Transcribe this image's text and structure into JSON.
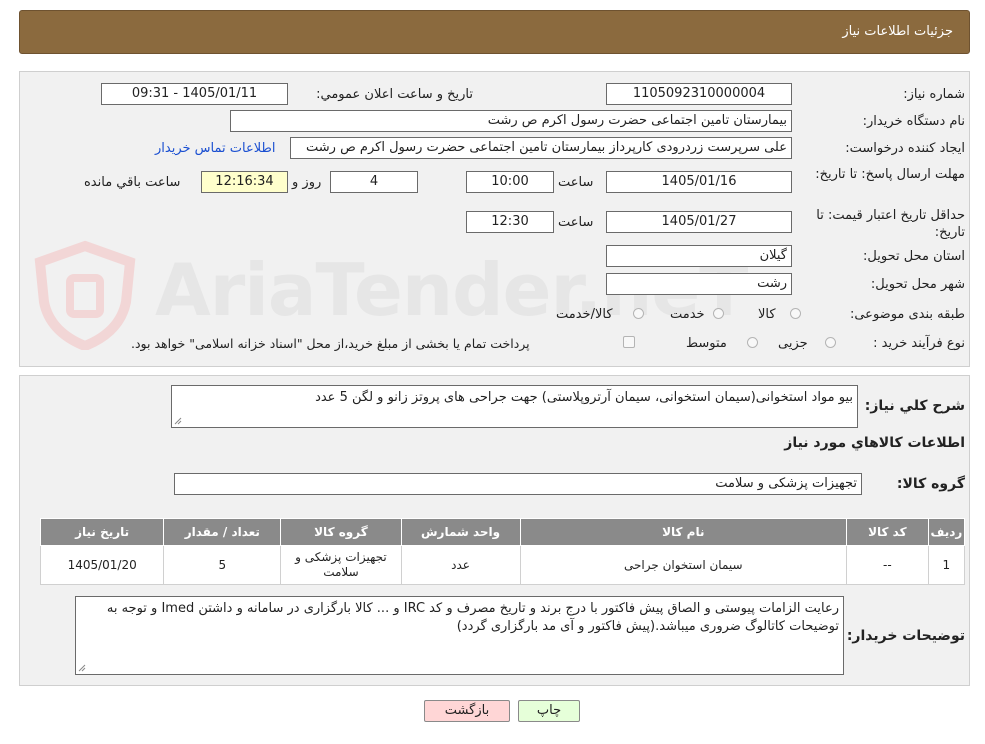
{
  "header": {
    "title": "جزئیات اطلاعات نیاز"
  },
  "watermark": {
    "text": "AriaTender.neT"
  },
  "form": {
    "need_number": {
      "label": "شماره نیاز:",
      "value": "1105092310000004"
    },
    "announce_datetime": {
      "label": "تاریخ و ساعت اعلان عمومي:",
      "value": "1405/01/11 - 09:31"
    },
    "buyer_org": {
      "label": "نام دستگاه خریدار:",
      "value": "بیمارستان  تامین اجتماعی حضرت رسول اکرم ص رشت"
    },
    "requester": {
      "label": "ایجاد کننده درخواست:",
      "value": "علی سرپرست زردرودی کارپرداز بیمارستان  تامین اجتماعی حضرت رسول اکرم ص رشت"
    },
    "contact_link": "اطلاعات تماس خریدار",
    "response_deadline": {
      "label": "مهلت ارسال پاسخ: تا تاریخ:",
      "date": "1405/01/16",
      "time_label": "ساعت",
      "time": "10:00",
      "days": "4",
      "days_label": "روز و",
      "remaining": "12:16:34",
      "remaining_label": "ساعت باقي مانده"
    },
    "price_validity": {
      "label": "حداقل تاریخ اعتبار قیمت: تا تاریخ:",
      "date": "1405/01/27",
      "time_label": "ساعت",
      "time": "12:30"
    },
    "province": {
      "label": "استان محل تحویل:",
      "value": "گیلان"
    },
    "city": {
      "label": "شهر محل تحویل:",
      "value": "رشت"
    },
    "category": {
      "label": "طبقه بندی موضوعی:",
      "options": [
        "کالا",
        "خدمت",
        "کالا/خدمت"
      ]
    },
    "purchase_type": {
      "label": "نوع فرآیند خرید :",
      "options": [
        "جزیی",
        "متوسط"
      ],
      "payment_note": "پرداخت تمام یا بخشی از مبلغ خرید،از محل \"اسناد خزانه اسلامی\" خواهد بود."
    }
  },
  "description": {
    "label": "شرح کلي نیاز:",
    "value": "بیو مواد استخوانی(سیمان استخوانی، سیمان آرتروپلاستی) جهت جراحی های پروتز زانو و لگن 5 عدد"
  },
  "goods_section": {
    "title": "اطلاعات کالاهاي مورد نیاز",
    "group_label": "گروه کالا:",
    "group_value": "تجهیزات پزشکی و سلامت"
  },
  "table": {
    "headers": [
      "ردیف",
      "کد کالا",
      "نام کالا",
      "واحد شمارش",
      "گروه کالا",
      "تعداد / مقدار",
      "تاریخ نیاز"
    ],
    "rows": [
      {
        "row": "1",
        "code": "--",
        "name": "سیمان استخوان جراحی",
        "unit": "عدد",
        "group": "تجهیزات پزشکی و سلامت",
        "qty": "5",
        "date": "1405/01/20"
      }
    ]
  },
  "buyer_notes": {
    "label": "توضیحات خریدار:",
    "value": "رعایت الزامات پیوستی و الصاق پیش فاکتور با درج برند و تاریخ مصرف و کد IRC و ... کالا بارگزاری در سامانه و داشتن Imed و توجه به توضیحات کاتالوگ ضروری میباشد.(پیش فاکتور و آی مد بارگزاری گردد)"
  },
  "buttons": {
    "print": "چاپ",
    "back": "بازگشت"
  },
  "colors": {
    "header_bg": "#8b6a3e",
    "table_header_bg": "#8a8a8a",
    "back_button_bg": "#ffd6d6",
    "print_button_bg": "#e6ffd9",
    "link": "#1a4fd1"
  }
}
